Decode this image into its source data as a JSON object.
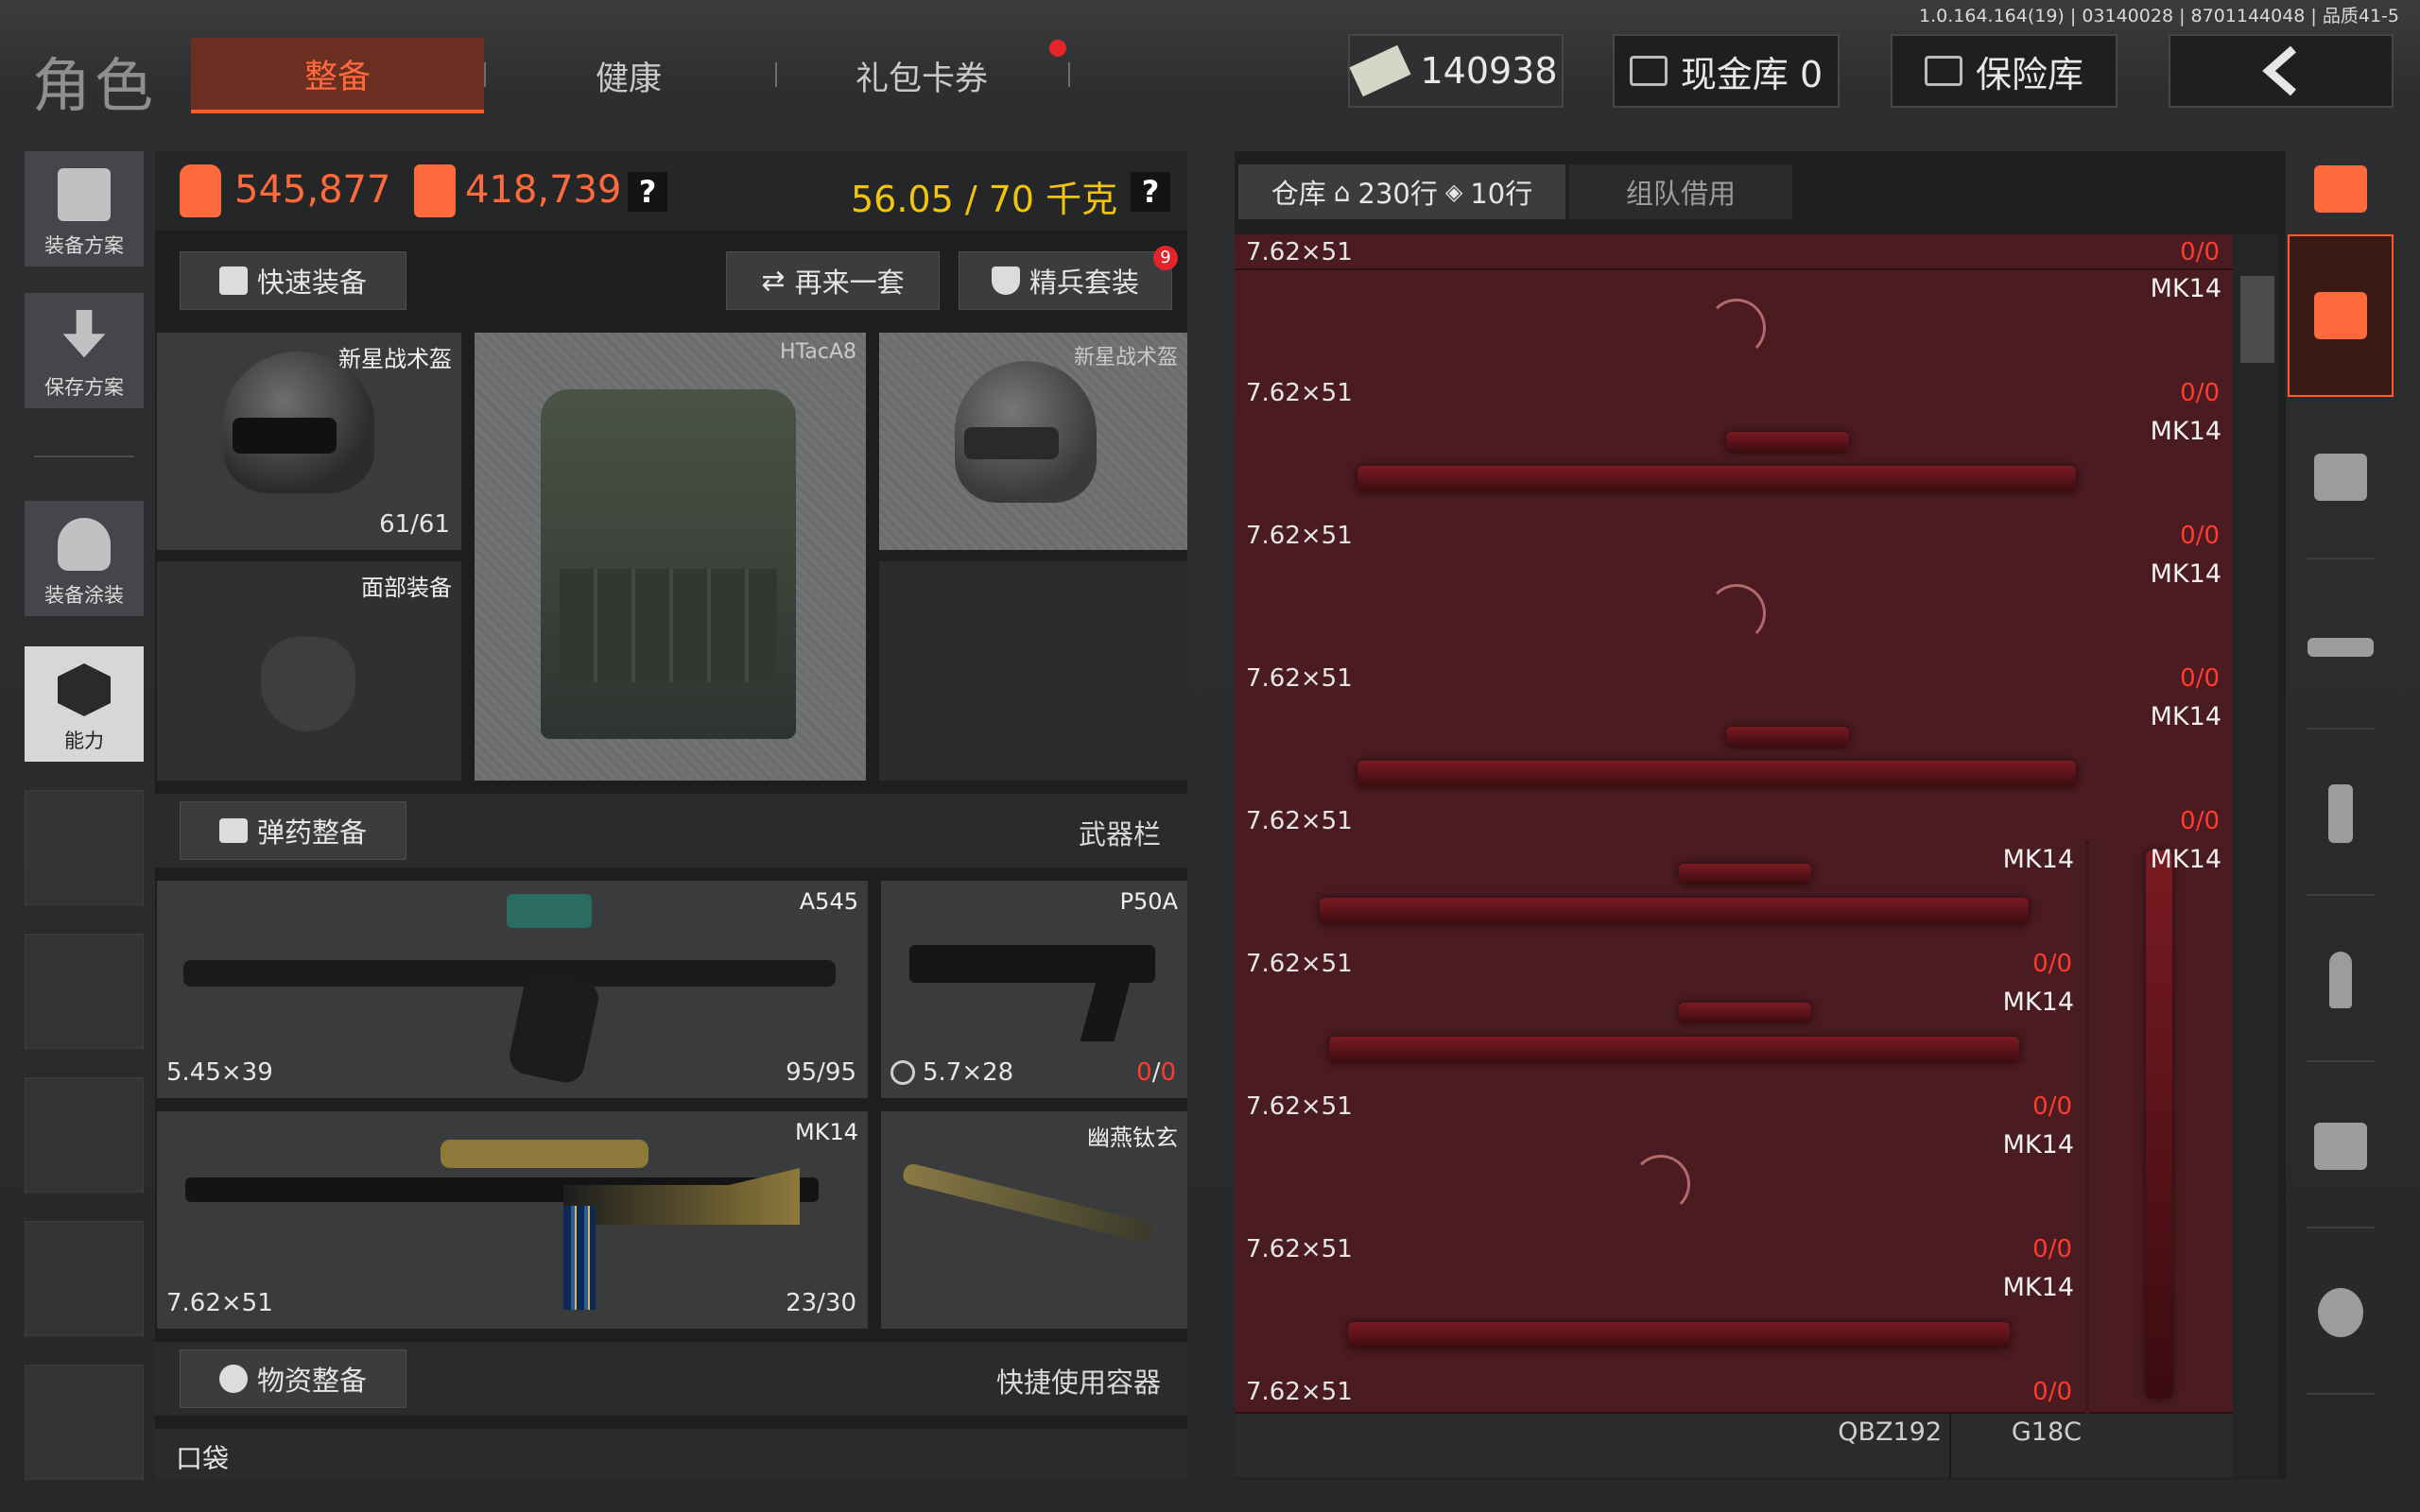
{
  "version": "1.0.164.164(19) | 03140028 | 8701144048 | 品质41-5",
  "title": "角色",
  "tabs": [
    {
      "label": "整备"
    },
    {
      "label": "健康"
    },
    {
      "label": "礼包卡券"
    }
  ],
  "currency": {
    "cash": "140938",
    "cash_vault": "现金库 0",
    "safe": "保险库"
  },
  "sidebar": [
    {
      "label": "装备方案"
    },
    {
      "label": "保存方案"
    },
    {
      "label": "装备涂装"
    },
    {
      "label": "能力"
    }
  ],
  "stats": {
    "value1": "545,877",
    "value2": "418,739",
    "weight": "56.05 / 70 千克",
    "help": "?"
  },
  "actions": {
    "quick_equip": "快速装备",
    "again": "再来一套",
    "elite": "精兵套装",
    "elite_badge": "9"
  },
  "gear": {
    "helmet": {
      "name": "新星战术盔",
      "durability": "61/61"
    },
    "face": {
      "name": "面部装备"
    },
    "vest": {
      "name": "HTacA8"
    },
    "helmet2": {
      "name": "新星战术盔"
    }
  },
  "ammo_section": {
    "button": "弹药整备",
    "label": "武器栏"
  },
  "weapons": {
    "primary": {
      "name": "A545",
      "caliber": "5.45×39",
      "ammo": "95/95"
    },
    "pistol": {
      "name": "P50A",
      "caliber": "5.7×28",
      "count_current": "0",
      "count_sep": "/",
      "count_max": "0"
    },
    "secondary": {
      "name": "MK14",
      "caliber": "7.62×51",
      "ammo": "23/30"
    },
    "melee": {
      "name": "幽燕钛玄"
    }
  },
  "supply_section": {
    "button": "物资整备",
    "label": "快捷使用容器"
  },
  "pocket": {
    "label": "口袋"
  },
  "warehouse": {
    "tab": "仓库",
    "rows": "230行",
    "rows2": "10行",
    "team": "组队借用",
    "items": [
      {
        "name": "",
        "caliber": "7.62×51",
        "count": "0/0"
      },
      {
        "name": "MK14",
        "caliber": "7.62×51",
        "count": "0/0"
      },
      {
        "name": "MK14",
        "caliber": "7.62×51",
        "count": "0/0"
      },
      {
        "name": "MK14",
        "caliber": "7.62×51",
        "count": "0/0"
      },
      {
        "name": "MK14",
        "caliber": "7.62×51",
        "count": "0/0"
      },
      {
        "name": "MK14",
        "caliber": "7.62×51",
        "count": "0/0"
      },
      {
        "name": "MK14",
        "caliber": "7.62×51",
        "count": "0/0"
      },
      {
        "name": "MK14",
        "caliber": "7.62×51",
        "count": "0/0"
      },
      {
        "name": "MK14",
        "caliber": "7.62×51",
        "count": "0/0"
      }
    ],
    "tall_item": {
      "name": "MK14"
    },
    "bottom_items": [
      {
        "name": "QBZ192"
      },
      {
        "name": "G18C"
      }
    ]
  },
  "categories": [
    "stack-icon",
    "storage-icon",
    "vest-icon",
    "rifle-icon",
    "magazine-icon",
    "ammo-icon",
    "scope-icon",
    "grenade-icon"
  ],
  "colors": {
    "accent": "#ff5a2a",
    "warehouse_bg": "#4a1b20",
    "weight": "#f1c40f",
    "count": "#ff3b30"
  }
}
